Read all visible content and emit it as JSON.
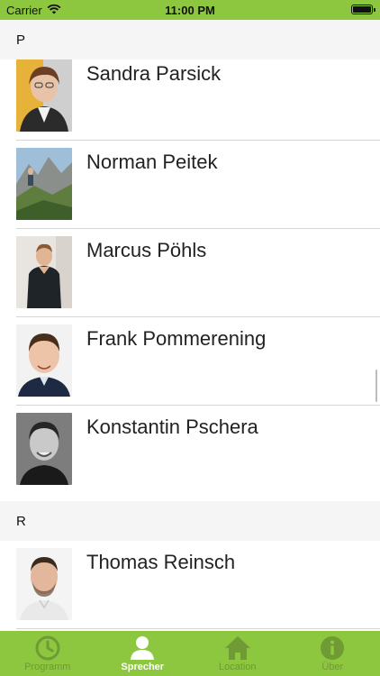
{
  "status_bar": {
    "carrier": "Carrier",
    "time": "11:00 PM"
  },
  "sections": [
    {
      "letter": "P",
      "speakers": [
        {
          "name": "Sandra Parsick"
        },
        {
          "name": "Norman Peitek"
        },
        {
          "name": "Marcus Pöhls"
        },
        {
          "name": "Frank Pommerening"
        },
        {
          "name": "Konstantin Pschera"
        }
      ]
    },
    {
      "letter": "R",
      "speakers": [
        {
          "name": "Thomas Reinsch"
        }
      ]
    }
  ],
  "tabbar": {
    "tabs": [
      {
        "label": "Programm",
        "icon": "clock-icon",
        "active": false
      },
      {
        "label": "Sprecher",
        "icon": "person-icon",
        "active": true
      },
      {
        "label": "Location",
        "icon": "home-icon",
        "active": false
      },
      {
        "label": "Über",
        "icon": "info-icon",
        "active": false
      }
    ]
  },
  "colors": {
    "accent": "#8dc63f",
    "section_bg": "#f5f5f5",
    "separator": "#d6d6d6"
  }
}
